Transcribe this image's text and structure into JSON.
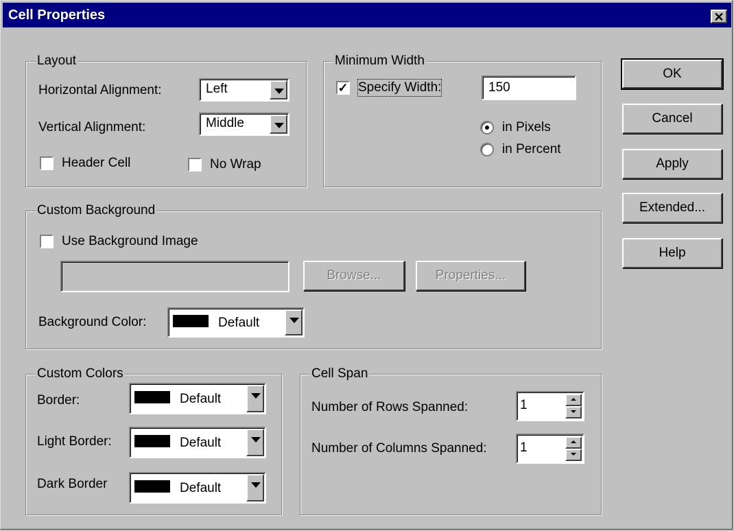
{
  "dialog": {
    "title": "Cell Properties",
    "close_glyph": "✕"
  },
  "layout": {
    "legend": "Layout",
    "horizontal_alignment_label": "Horizontal Alignment:",
    "horizontal_alignment_value": "Left",
    "vertical_alignment_label": "Vertical Alignment:",
    "vertical_alignment_value": "Middle",
    "header_cell_label": "Header Cell",
    "header_cell_checked": false,
    "no_wrap_label": "No Wrap",
    "no_wrap_checked": false
  },
  "minimum_width": {
    "legend": "Minimum Width",
    "specify_width_label": "Specify Width:",
    "specify_width_checked": true,
    "width_value": "150",
    "in_pixels_label": "in Pixels",
    "in_percent_label": "in Percent",
    "selected_unit": "pixels"
  },
  "buttons": {
    "ok": "OK",
    "cancel": "Cancel",
    "apply": "Apply",
    "extended": "Extended...",
    "help": "Help"
  },
  "custom_background": {
    "legend": "Custom Background",
    "use_bg_image_label": "Use Background Image",
    "use_bg_image_checked": false,
    "image_path_value": "",
    "browse_label": "Browse...",
    "properties_label": "Properties...",
    "bg_color_label": "Background Color:",
    "bg_color_value": "Default",
    "bg_color_swatch": "#000000"
  },
  "custom_colors": {
    "legend": "Custom Colors",
    "border_label": "Border:",
    "border_value": "Default",
    "light_border_label": "Light Border:",
    "light_border_value": "Default",
    "dark_border_label": "Dark Border",
    "dark_border_value": "Default"
  },
  "cell_span": {
    "legend": "Cell Span",
    "rows_label": "Number of Rows Spanned:",
    "rows_value": "1",
    "columns_label": "Number of Columns Spanned:",
    "columns_value": "1"
  },
  "colors": {
    "titlebar": "#000080",
    "face": "#c0c0c0"
  }
}
